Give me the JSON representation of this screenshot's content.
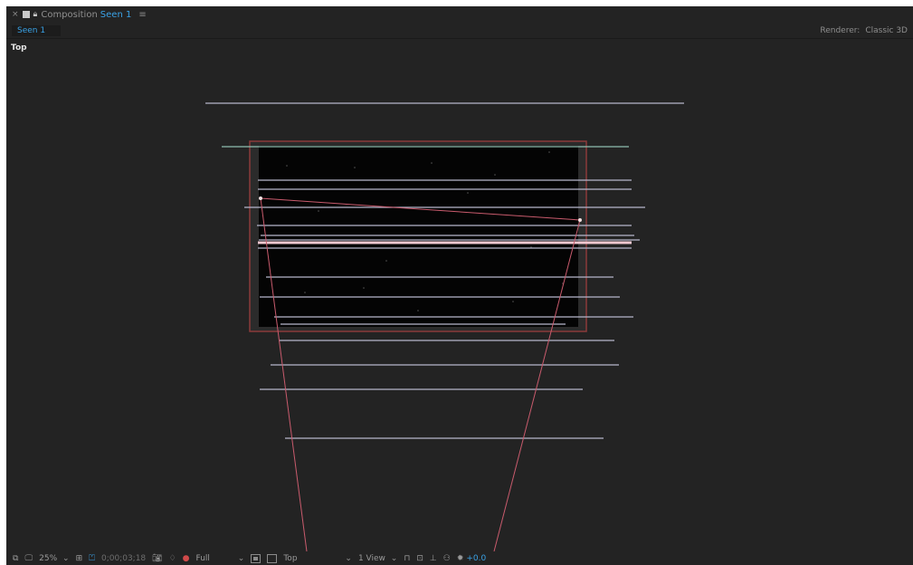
{
  "header": {
    "close": "×",
    "comp_prefix": "Composition",
    "comp_name": "Seen 1",
    "menu": "≡"
  },
  "tab": {
    "label": "Seen 1"
  },
  "renderer": {
    "label": "Renderer:",
    "value": "Classic 3D"
  },
  "viewer": {
    "view_label": "Top"
  },
  "toolbar": {
    "zoom": "25%",
    "timecode": "0;00;03;18",
    "resolution": "Full",
    "view": "Top",
    "view_layout": "1 View",
    "exposure": "+0.0"
  },
  "colors": {
    "panel_bg": "#232323",
    "accent_blue": "#3aa2e6",
    "comp_frame": "#8b3a3a",
    "camera_line": "#c95b6d",
    "layer_line": "#b6b6cc"
  },
  "icons": [
    "close-icon",
    "comp-swatch-icon",
    "lock-icon",
    "menu-icon",
    "region-icon",
    "monitor-icon",
    "safe-margins-icon",
    "mask-icon",
    "snapshot-icon",
    "show-snapshot-icon",
    "color-channel-icon",
    "transparency-grid-icon",
    "fast-preview-icon",
    "timeline-icon",
    "flowchart-icon",
    "exposure-icon"
  ]
}
